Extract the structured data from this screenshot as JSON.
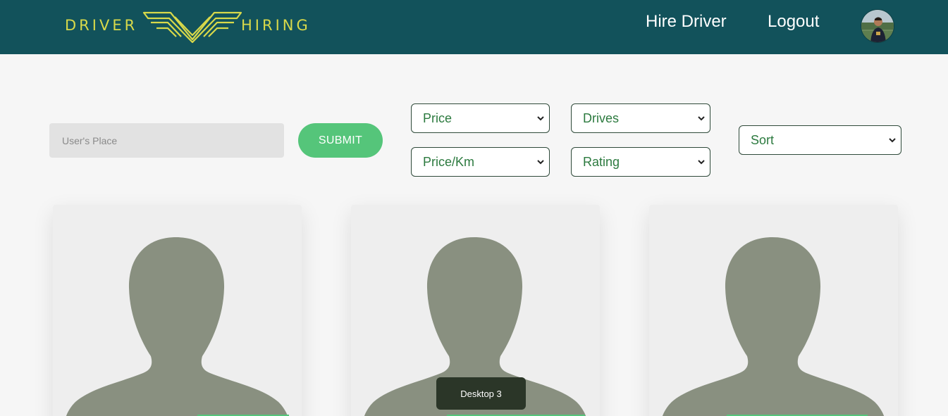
{
  "navbar": {
    "logo_left": "DRIVER",
    "logo_right": "HIRING",
    "links": {
      "hire_driver": "Hire Driver",
      "logout": "Logout"
    }
  },
  "search": {
    "placeholder": "User's Place",
    "submit_label": "SUBMIT"
  },
  "filters": {
    "price": "Price",
    "drives": "Drives",
    "price_per_km": "Price/Km",
    "rating": "Rating",
    "sort": "Sort"
  },
  "tooltip": "Desktop 3",
  "colors": {
    "navbar": "#12525b",
    "logo": "#d8d94a",
    "accent_green": "#55c57a",
    "silhouette": "#899080",
    "select_text": "#2c7a3f"
  }
}
